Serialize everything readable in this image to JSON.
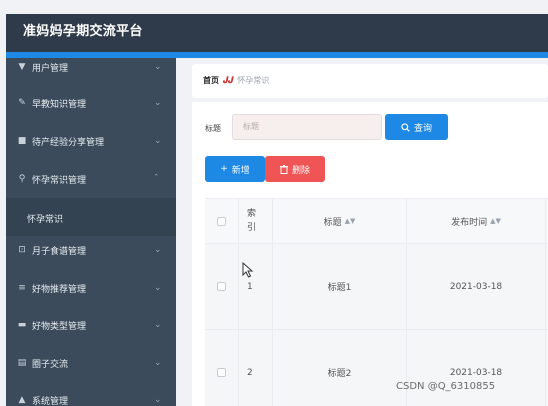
{
  "app": {
    "title": "准妈妈孕期交流平台"
  },
  "sidebar": {
    "items": [
      {
        "label": "用户管理",
        "icon": "user-icon",
        "expanded": false
      },
      {
        "label": "早教知识管理",
        "icon": "edit-icon",
        "expanded": false
      },
      {
        "label": "待产经验分享管理",
        "icon": "bag-icon",
        "expanded": false
      },
      {
        "label": "怀孕常识管理",
        "icon": "mic-icon",
        "expanded": true
      },
      {
        "label": "月子食谱管理",
        "icon": "crop-icon",
        "expanded": false
      },
      {
        "label": "好物推荐管理",
        "icon": "sliders-icon",
        "expanded": false
      },
      {
        "label": "好物类型管理",
        "icon": "tag-icon",
        "expanded": false
      },
      {
        "label": "圈子交流",
        "icon": "note-icon",
        "expanded": false
      },
      {
        "label": "系统管理",
        "icon": "shield-icon",
        "expanded": false
      }
    ],
    "submenu": {
      "label": "怀孕常识"
    }
  },
  "breadcrumb": {
    "home": "首页",
    "separator": "𝑱𝑱",
    "current": "怀孕常识"
  },
  "search": {
    "label": "标题",
    "placeholder": "标题",
    "button": "查询"
  },
  "actions": {
    "add": "新增",
    "delete": "删除"
  },
  "table": {
    "headers": {
      "index_line1": "索",
      "index_line2": "引",
      "title": "标题",
      "date": "发布时间"
    },
    "rows": [
      {
        "index": "1",
        "title": "标题1",
        "date": "2021-03-18"
      },
      {
        "index": "2",
        "title": "标题2",
        "date": "2021-03-18"
      }
    ]
  },
  "watermark": "CSDN @Q_6310855",
  "colors": {
    "header": "#2f3a4a",
    "sidebar": "#3b4b5b",
    "accent": "#1e88e5",
    "danger": "#f05454"
  }
}
